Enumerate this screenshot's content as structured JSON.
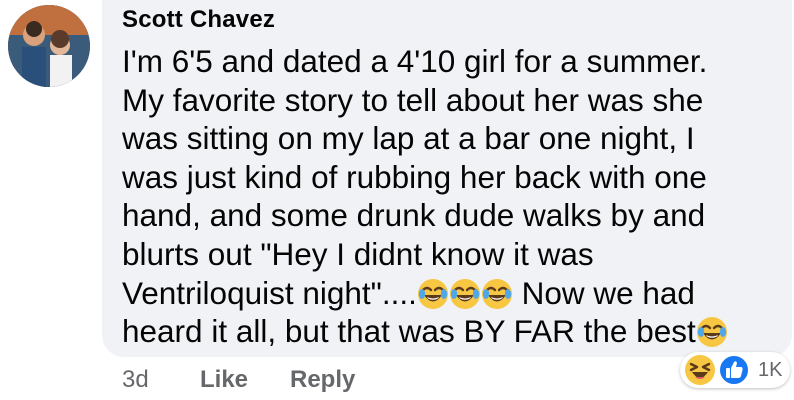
{
  "comment": {
    "author": "Scott Chavez",
    "lines": [
      "I'm 6'5 and dated a 4'10 girl for a summer.",
      "My favorite story to tell about her was she",
      "was sitting on my lap at a bar one night, I",
      "was just kind of rubbing her back with one",
      "hand, and some drunk dude walks by and",
      "blurts out \"Hey I didnt know it was",
      "Ventriloquist night\"....",
      " Now we had",
      "heard it all, but that was BY FAR the best"
    ],
    "inline_emoji": "face-with-tears-of-joy-icon"
  },
  "reactions": {
    "icons": [
      "haha-reaction-icon",
      "like-reaction-icon"
    ],
    "count": "1K"
  },
  "actions": {
    "age": "3d",
    "like_label": "Like",
    "reply_label": "Reply"
  },
  "colors": {
    "bubble": "#f0f2f5",
    "text": "#050505",
    "muted": "#65676b",
    "like_blue": "#1877f2",
    "emoji_yellow": "#f7c744"
  }
}
